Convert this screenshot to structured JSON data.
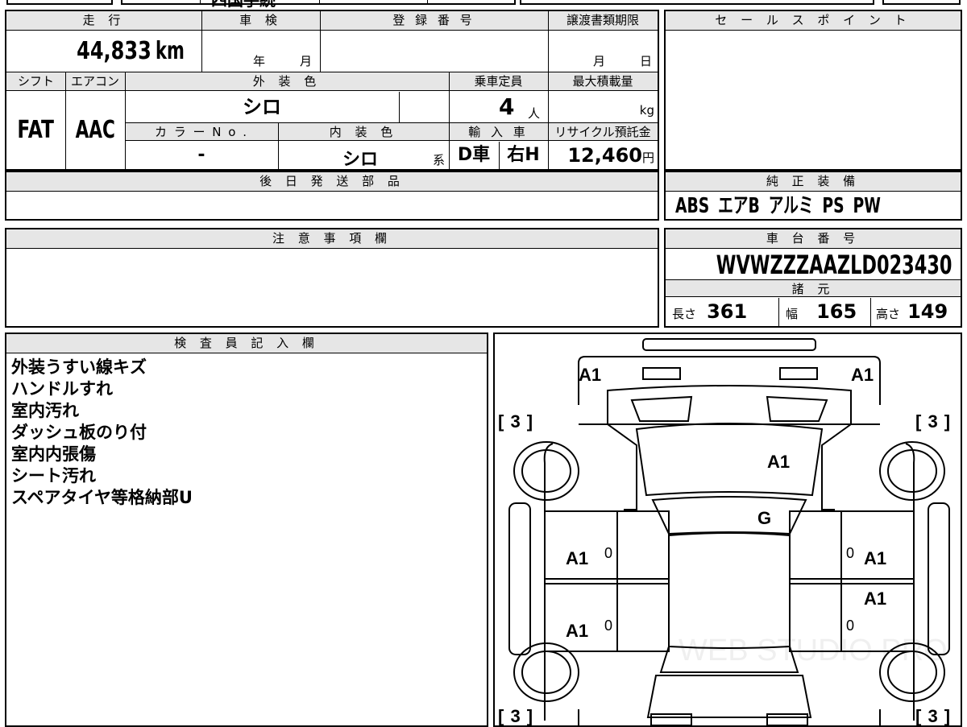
{
  "top_stub": {
    "middle_text": "四国手続"
  },
  "vehicle": {
    "mileage_label": "走 行",
    "mileage_value": "44,833",
    "inspection_label": "車 検",
    "inspection_year": "年",
    "inspection_month": "月",
    "registration_label": "登 録 番 号",
    "registration_value": "",
    "transfer_label": "譲渡書類期限",
    "transfer_month": "月",
    "transfer_day": "日",
    "shift_label": "シフト",
    "shift_value": "FAT",
    "ac_label": "エアコン",
    "ac_value": "AAC",
    "exterior_color_label": "外 装 色",
    "exterior_color_value": "シロ",
    "capacity_label": "乗車定員",
    "capacity_value": "4",
    "capacity_unit": "人",
    "max_load_label": "最大積載量",
    "max_load_unit": "kg",
    "color_no_label": "カ ラ ー N o .",
    "color_no_value": "-",
    "interior_color_label": "内 装 色",
    "interior_color_value": "シロ",
    "interior_color_suffix": "系",
    "import_label": "輸 入 車",
    "import_value_1": "D車",
    "import_value_2": "右H",
    "recycle_label": "リサイクル預託金",
    "recycle_value": "12,460",
    "recycle_unit": "円"
  },
  "sales_point": {
    "label": "セ ー ル ス ポ イ ン ト",
    "value": ""
  },
  "later_parts": {
    "label": "後 日 発 送 部 品",
    "value": ""
  },
  "genuine_equipment": {
    "label": "純 正 装 備",
    "value": "ABS エアB アルミ PS PW"
  },
  "caution": {
    "label": "注 意 事 項 欄",
    "value": ""
  },
  "chassis": {
    "label": "車 台 番 号",
    "value": "WVWZZZAAZLD023430"
  },
  "specs": {
    "label": "諸 元",
    "length_label": "長さ",
    "length_value": "361",
    "width_label": "幅",
    "width_value": "165",
    "height_label": "高さ",
    "height_value": "149"
  },
  "inspector": {
    "label": "検 査 員 記 入 欄",
    "notes": [
      "外装うすい線キズ",
      "ハンドルすれ",
      "室内汚れ",
      "ダッシュ板のり付",
      "室内内張傷",
      "シート汚れ",
      "スペアタイヤ等格納部U"
    ]
  },
  "diagram": {
    "labels": {
      "front_left": "A1",
      "front_right": "A1",
      "hood": "A1",
      "windshield": "G",
      "left_front_door": "A1",
      "right_front_door": "A1",
      "left_rear_door": "A1",
      "right_rear_door": "A1",
      "tire_fl": "[ 3 ]",
      "tire_fr": "[ 3 ]",
      "tire_rl": "[ 3 ]",
      "tire_rr": "[ 3 ]",
      "zero": "0"
    },
    "watermark": "WEB STUDIO PRO"
  }
}
